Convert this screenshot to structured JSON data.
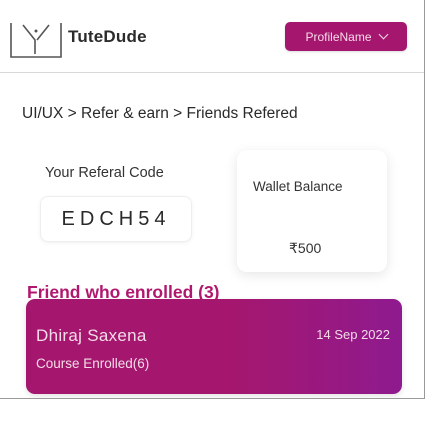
{
  "header": {
    "brand": "TuteDude",
    "profile_label": "ProfileName"
  },
  "breadcrumb": "UI/UX > Refer & earn > Friends Refered",
  "referral": {
    "label": "Your Referal Code",
    "code": "EDCH54"
  },
  "wallet": {
    "label": "Wallet Balance",
    "amount": "₹500"
  },
  "friends": {
    "title": "Friend who enrolled (3)",
    "items": [
      {
        "name": "Dhiraj Saxena",
        "date": "14 Sep 2022",
        "courses": "Course Enrolled(6)"
      }
    ]
  },
  "colors": {
    "accent": "#a5176e",
    "accent_end": "#8e1a8f"
  }
}
